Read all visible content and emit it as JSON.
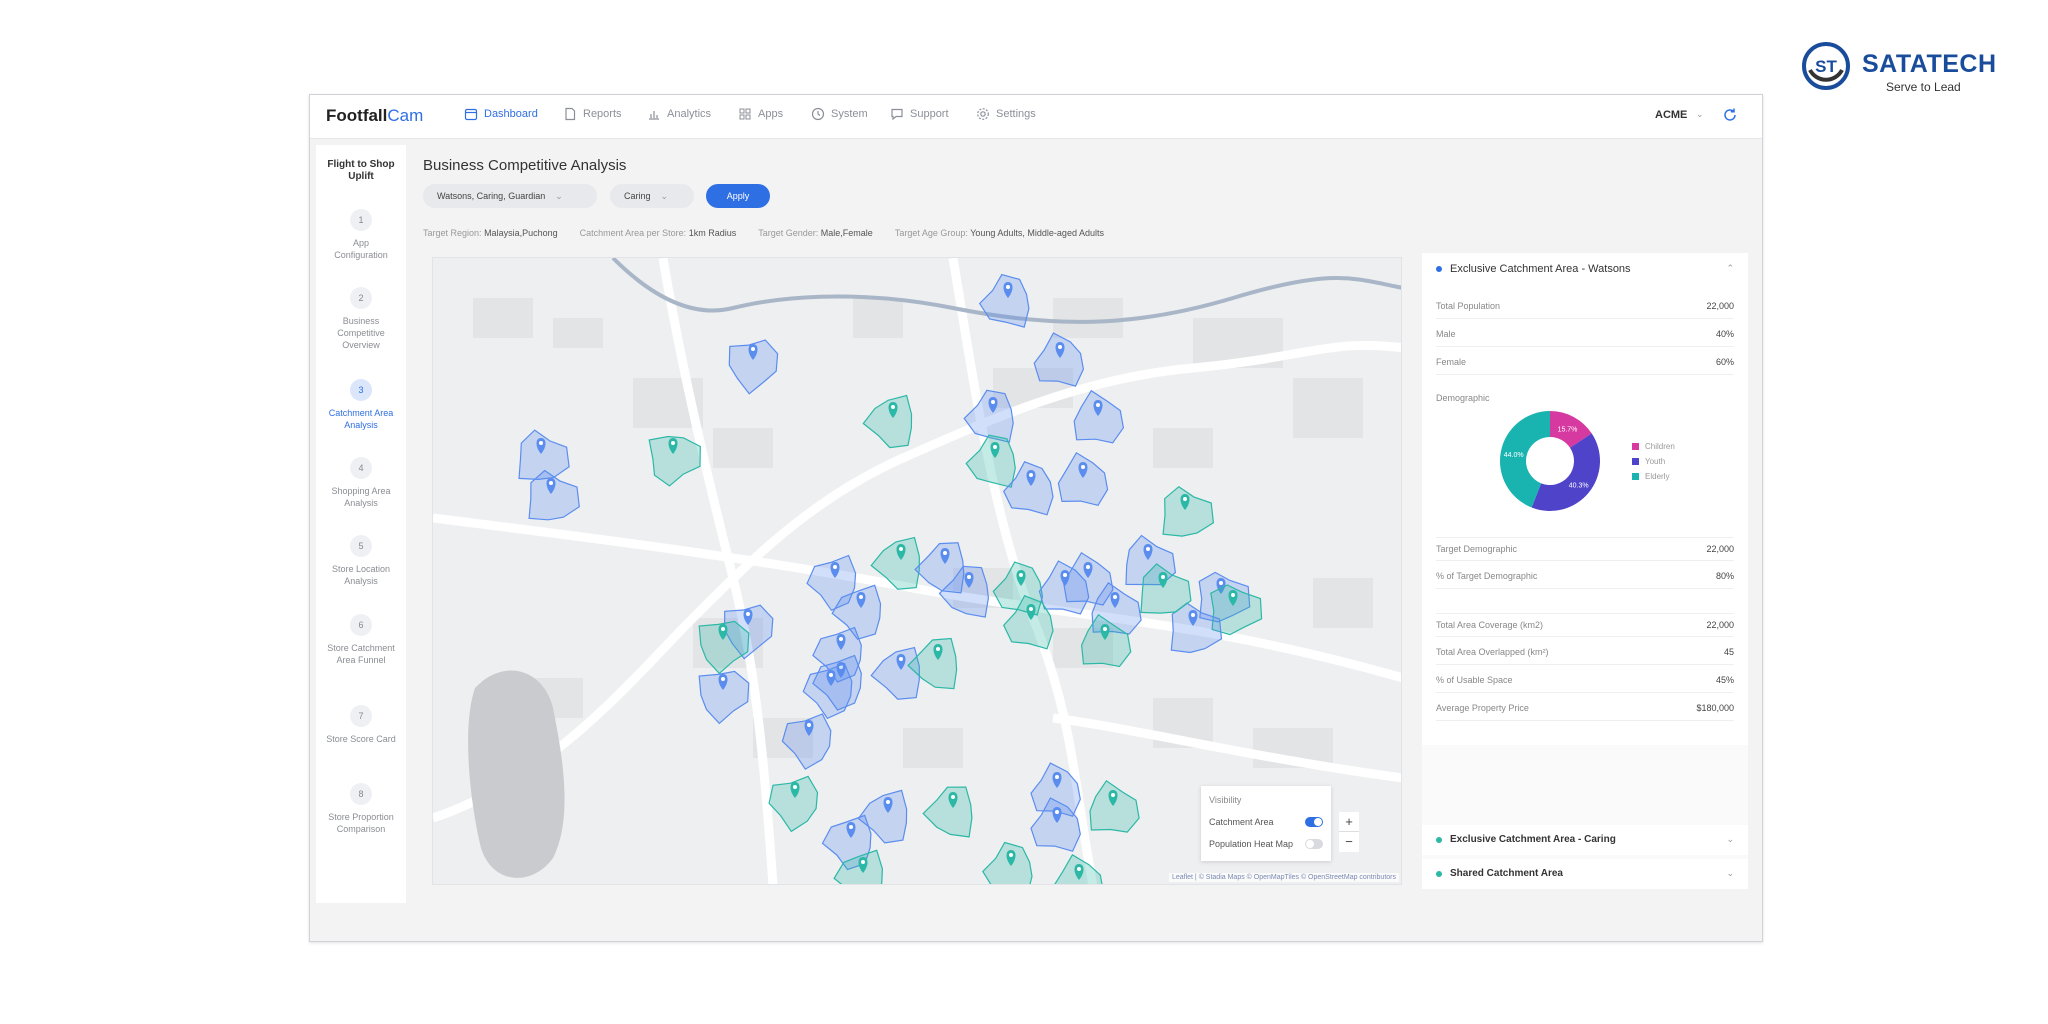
{
  "brand": {
    "name": "SATATECH",
    "tagline": "Serve to Lead",
    "monogram": "ST"
  },
  "app": {
    "logo_main": "Footfall",
    "logo_accent": "Cam",
    "nav": [
      {
        "label": "Dashboard",
        "icon": "calendar-icon",
        "active": true
      },
      {
        "label": "Reports",
        "icon": "doc-icon"
      },
      {
        "label": "Analytics",
        "icon": "bar-chart-icon"
      },
      {
        "label": "Apps",
        "icon": "grid-icon"
      },
      {
        "label": "System",
        "icon": "clock-icon"
      },
      {
        "label": "Support",
        "icon": "chat-icon"
      },
      {
        "label": "Settings",
        "icon": "gear-icon"
      }
    ],
    "account": "ACME"
  },
  "stepper": {
    "title": "Flight to Shop Uplift",
    "steps": [
      {
        "num": "1",
        "label": "App Configuration"
      },
      {
        "num": "2",
        "label": "Business Competitive Overview"
      },
      {
        "num": "3",
        "label": "Catchment Area Analysis",
        "active": true
      },
      {
        "num": "4",
        "label": "Shopping Area Analysis"
      },
      {
        "num": "5",
        "label": "Store Location Analysis"
      },
      {
        "num": "6",
        "label": "Store Catchment Area Funnel"
      },
      {
        "num": "7",
        "label": "Store Score Card"
      },
      {
        "num": "8",
        "label": "Store Proportion Comparison"
      }
    ]
  },
  "main": {
    "title": "Business Competitive Analysis",
    "filters": [
      "Watsons, Caring, Guardian",
      "Caring"
    ],
    "apply_label": "Apply",
    "targets": [
      {
        "k": "Target Region:",
        "v": "Malaysia,Puchong"
      },
      {
        "k": "Catchment Area per Store:",
        "v": "1km Radius"
      },
      {
        "k": "Target Gender:",
        "v": "Male,Female"
      },
      {
        "k": "Target Age Group:",
        "v": "Young Adults, Middle-aged Adults"
      }
    ]
  },
  "map": {
    "visibility_title": "Visibility",
    "layers": [
      {
        "label": "Catchment Area",
        "on": true
      },
      {
        "label": "Population Heat Map",
        "on": false
      }
    ],
    "zoom_in": "+",
    "zoom_out": "−",
    "attribution": "Leaflet | © Stadia Maps © OpenMapTiles © OpenStreetMap contributors",
    "colors": {
      "watsons": "#5b8def",
      "caring": "#2bb8a6"
    }
  },
  "panel": {
    "section1": {
      "title": "Exclusive Catchment Area - Watsons",
      "dot_color": "#2f6fe4",
      "rows_top": [
        {
          "k": "Total Population",
          "v": "22,000"
        },
        {
          "k": "Male",
          "v": "40%"
        },
        {
          "k": "Female",
          "v": "60%"
        }
      ],
      "demographic_label": "Demographic",
      "rows_mid": [
        {
          "k": "Target Demographic",
          "v": "22,000"
        },
        {
          "k": "% of Target Demographic",
          "v": "80%"
        }
      ],
      "rows_bottom": [
        {
          "k": "Total Area Coverage (km2)",
          "v": "22,000"
        },
        {
          "k": "Total Area Overlapped (km²)",
          "v": "45"
        },
        {
          "k": "% of Usable Space",
          "v": "45%"
        },
        {
          "k": "Average Property Price",
          "v": "$180,000"
        }
      ]
    },
    "section2": {
      "title": "Exclusive Catchment Area - Caring",
      "dot_color": "#2bb8a6"
    },
    "section3": {
      "title": "Shared Catchment Area",
      "dot_color": "#2bb8a6"
    }
  },
  "chart_data": {
    "type": "pie",
    "categories": [
      "Children",
      "Youth",
      "Elderly"
    ],
    "values": [
      15.7,
      40.3,
      44.0
    ],
    "labels": [
      "15.7%",
      "40.3%",
      "44.0%"
    ],
    "colors": [
      "#d63aa0",
      "#4f43c9",
      "#19b3b0"
    ]
  }
}
